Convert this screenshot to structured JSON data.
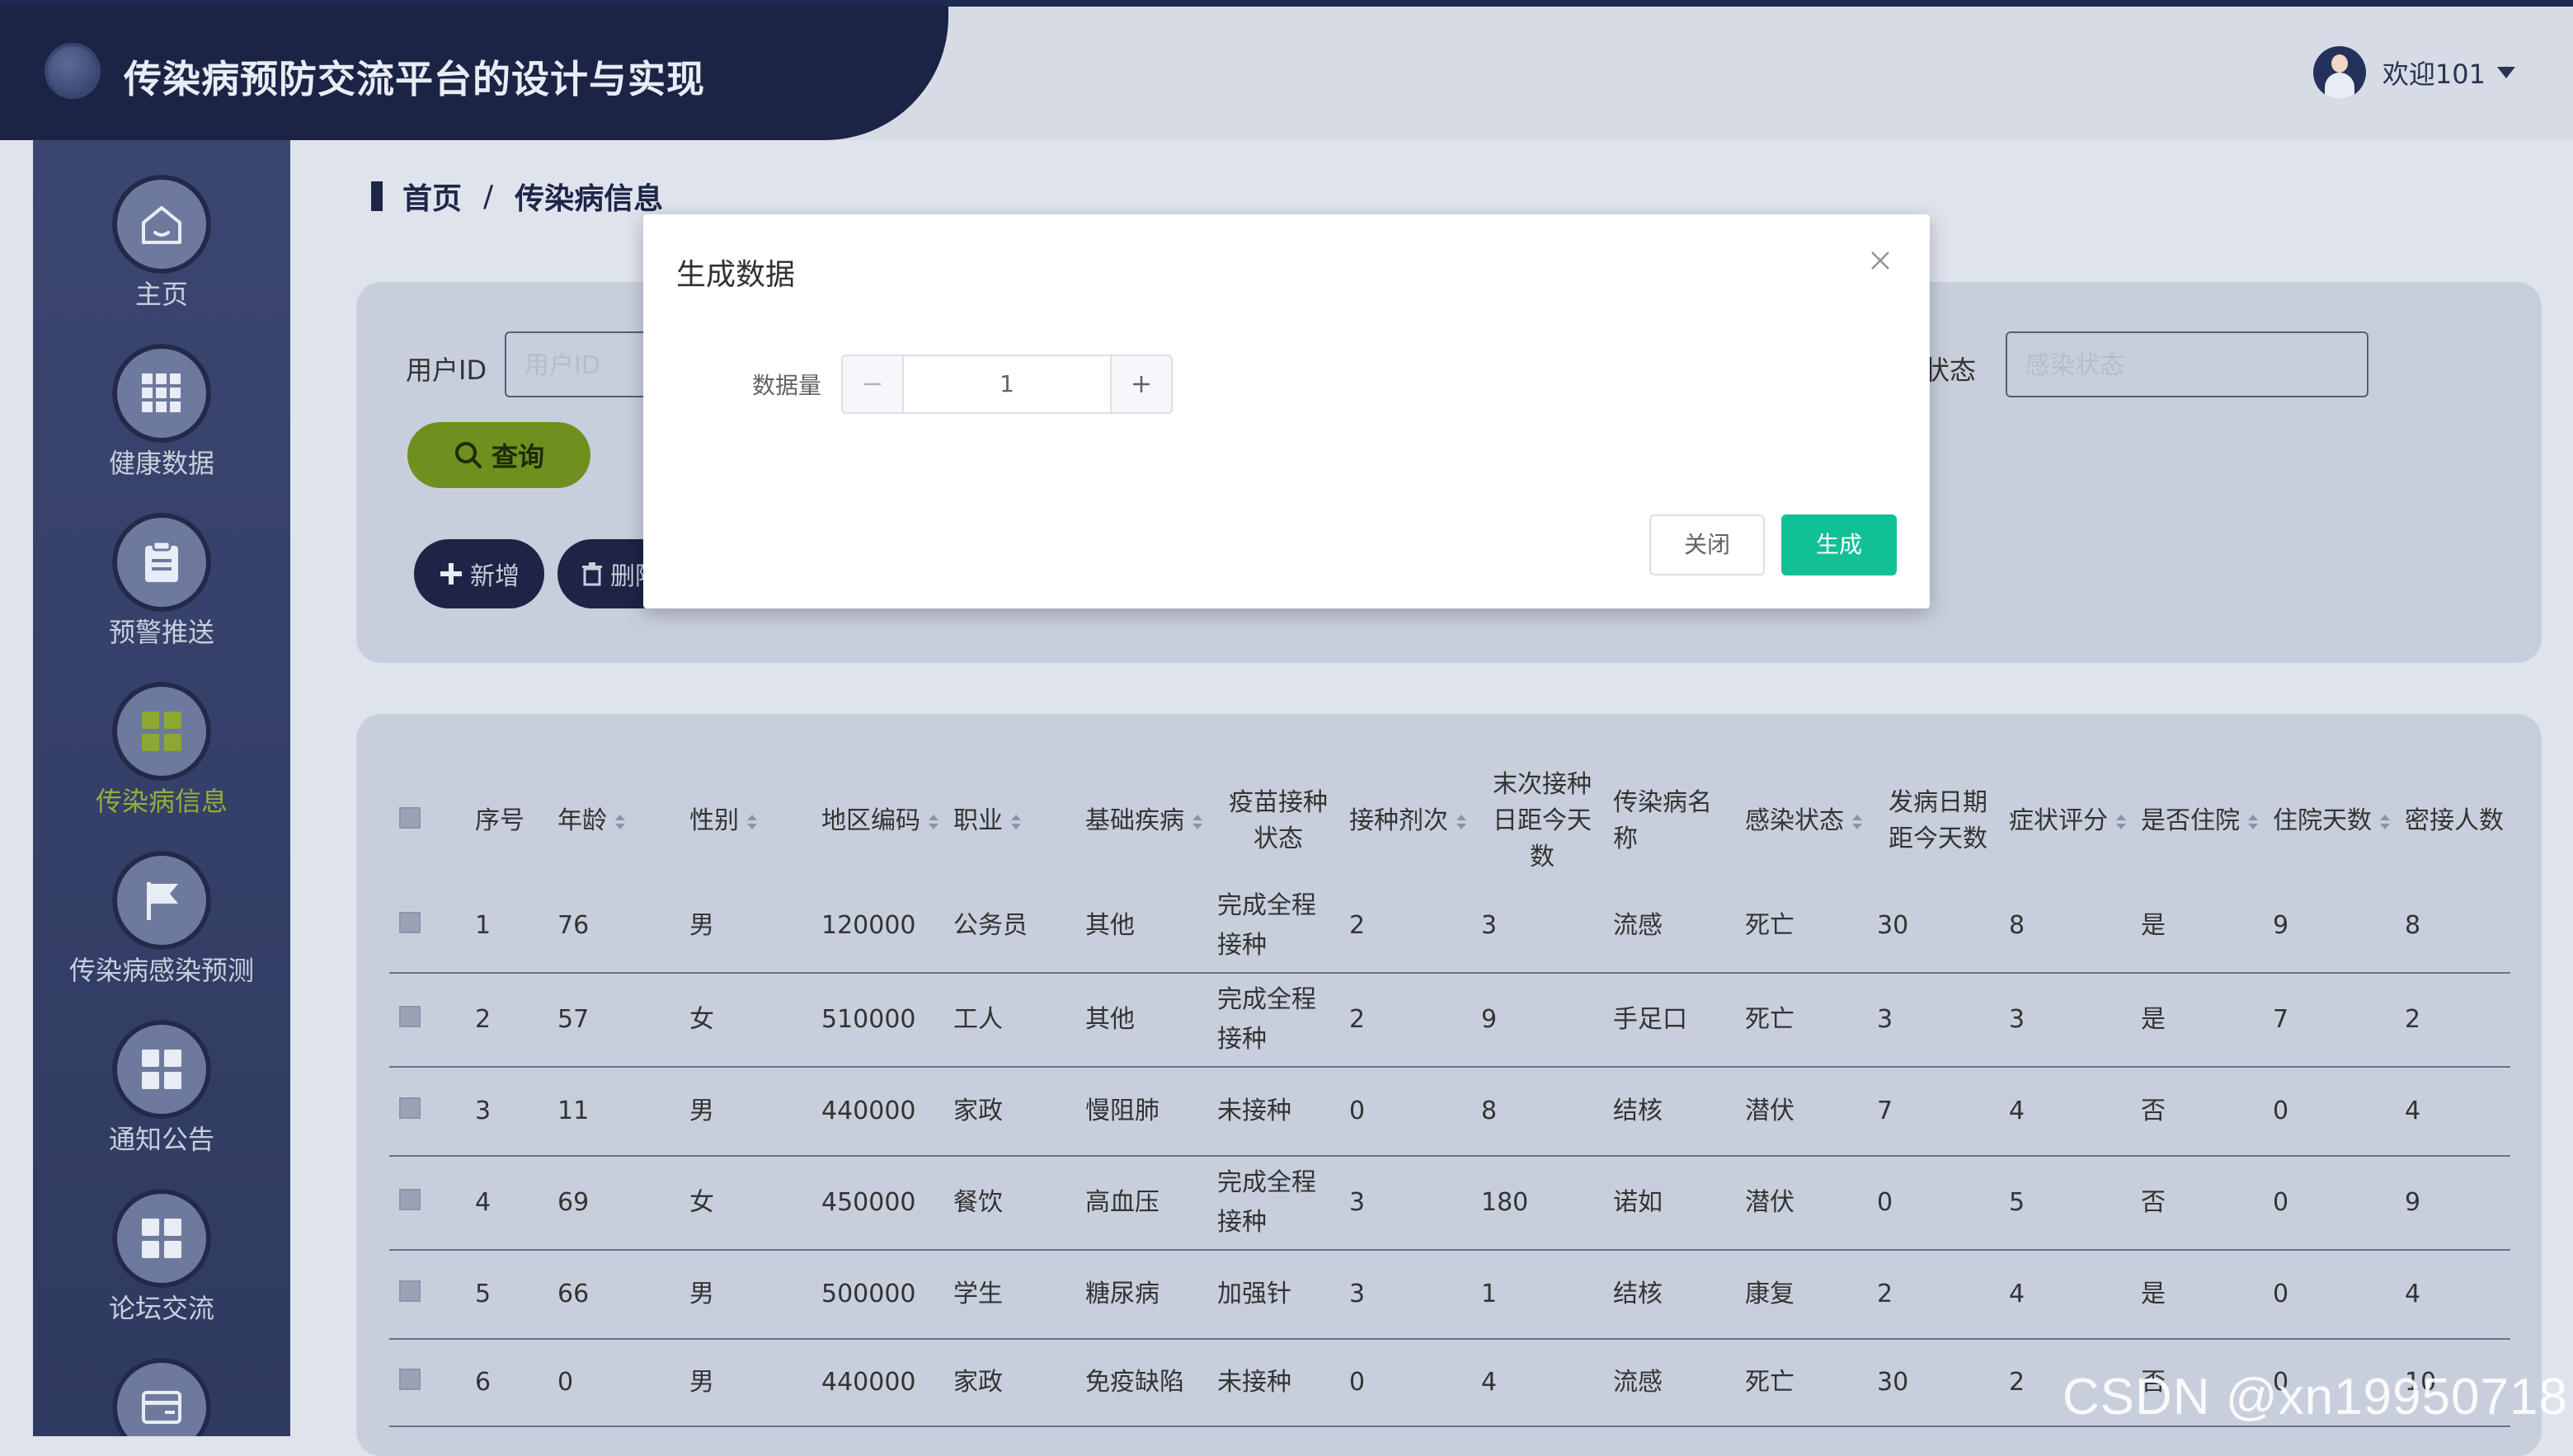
{
  "header": {
    "app_title": "传染病预防交流平台的设计与实现",
    "welcome": "欢迎101"
  },
  "sidebar": {
    "items": [
      {
        "label": "主页",
        "icon": "home-icon"
      },
      {
        "label": "健康数据",
        "icon": "grid-icon"
      },
      {
        "label": "预警推送",
        "icon": "clipboard-icon"
      },
      {
        "label": "传染病信息",
        "icon": "grid-icon",
        "active": true
      },
      {
        "label": "传染病感染预测",
        "icon": "flag-icon"
      },
      {
        "label": "通知公告",
        "icon": "grid-icon"
      },
      {
        "label": "论坛交流",
        "icon": "grid-icon"
      },
      {
        "label": "",
        "icon": "card-icon"
      }
    ]
  },
  "breadcrumb": {
    "home": "首页",
    "separator": "/",
    "current": "传染病信息"
  },
  "search": {
    "userid_label": "用户ID",
    "userid_placeholder": "用户ID",
    "status_label": "状态",
    "status_placeholder": "感染状态",
    "query_button": "查询",
    "add_button": "新增",
    "delete_button": "删除"
  },
  "table": {
    "headers": [
      "序号",
      "年龄",
      "性别",
      "地区编码",
      "职业",
      "基础疾病",
      "疫苗接种状态",
      "接种剂次",
      "末次接种日距今天数",
      "传染病名称",
      "感染状态",
      "发病日期距今天数",
      "症状评分",
      "是否住院",
      "住院天数",
      "密接人数"
    ],
    "rows": [
      [
        "1",
        "76",
        "男",
        "120000",
        "公务员",
        "其他",
        "完成全程接种",
        "2",
        "3",
        "流感",
        "死亡",
        "30",
        "8",
        "是",
        "9",
        "8"
      ],
      [
        "2",
        "57",
        "女",
        "510000",
        "工人",
        "其他",
        "完成全程接种",
        "2",
        "9",
        "手足口",
        "死亡",
        "3",
        "3",
        "是",
        "7",
        "2"
      ],
      [
        "3",
        "11",
        "男",
        "440000",
        "家政",
        "慢阻肺",
        "未接种",
        "0",
        "8",
        "结核",
        "潜伏",
        "7",
        "4",
        "否",
        "0",
        "4"
      ],
      [
        "4",
        "69",
        "女",
        "450000",
        "餐饮",
        "高血压",
        "完成全程接种",
        "3",
        "180",
        "诺如",
        "潜伏",
        "0",
        "5",
        "否",
        "0",
        "9"
      ],
      [
        "5",
        "66",
        "男",
        "500000",
        "学生",
        "糖尿病",
        "加强针",
        "3",
        "1",
        "结核",
        "康复",
        "2",
        "4",
        "是",
        "0",
        "4"
      ],
      [
        "6",
        "0",
        "男",
        "440000",
        "家政",
        "免疫缺陷",
        "未接种",
        "0",
        "4",
        "流感",
        "死亡",
        "30",
        "2",
        "否",
        "0",
        "10"
      ]
    ]
  },
  "modal": {
    "title": "生成数据",
    "field_label": "数据量",
    "value": "1",
    "close_button": "关闭",
    "generate_button": "生成"
  },
  "watermark": "CSDN @xn19950718",
  "colors": {
    "header_dark": "#1c2445",
    "sidebar": "#3b4670",
    "active_nav": "#95ad3c",
    "query_button": "#6f8f1f",
    "generate_button": "#12c096"
  }
}
